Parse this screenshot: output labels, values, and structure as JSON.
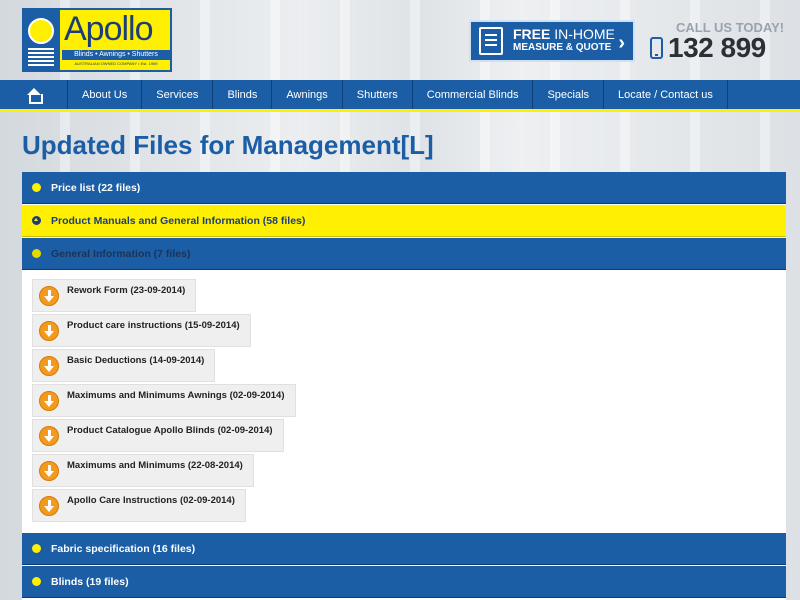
{
  "brand": {
    "name": "Apollo",
    "tagline": "Blinds • Awnings • Shutters",
    "sub": "AUSTRALIAN OWNED COMPANY • Est. 1969"
  },
  "quote": {
    "free": "FREE",
    "inhome": " IN-HOME",
    "line2": "MEASURE & QUOTE",
    "arrow": "›"
  },
  "call": {
    "label": "CALL US TODAY!",
    "number": "132 899"
  },
  "nav": {
    "items": [
      "About Us",
      "Services",
      "Blinds",
      "Awnings",
      "Shutters",
      "Commercial Blinds",
      "Specials",
      "Locate / Contact us"
    ]
  },
  "page": {
    "title": "Updated Files for Management[L]"
  },
  "sections": {
    "price_list": "Price list (22 files)",
    "product_manuals": "Product Manuals and General Information (58 files)",
    "general_info": "General Information (7 files)",
    "fabric_spec": "Fabric specification (16 files)",
    "blinds": "Blinds (19 files)"
  },
  "files": [
    "Rework Form (23-09-2014)",
    "Product care instructions (15-09-2014)",
    "Basic Deductions (14-09-2014)",
    "Maximums and Minimums Awnings (02-09-2014)",
    "Product Catalogue Apollo Blinds (02-09-2014)",
    "Maximums and Minimums (22-08-2014)",
    "Apollo Care Instructions (02-09-2014)"
  ],
  "colors": {
    "brand_blue": "#1b5ea6",
    "brand_yellow": "#ffef00",
    "download_orange": "#f39a1e"
  }
}
